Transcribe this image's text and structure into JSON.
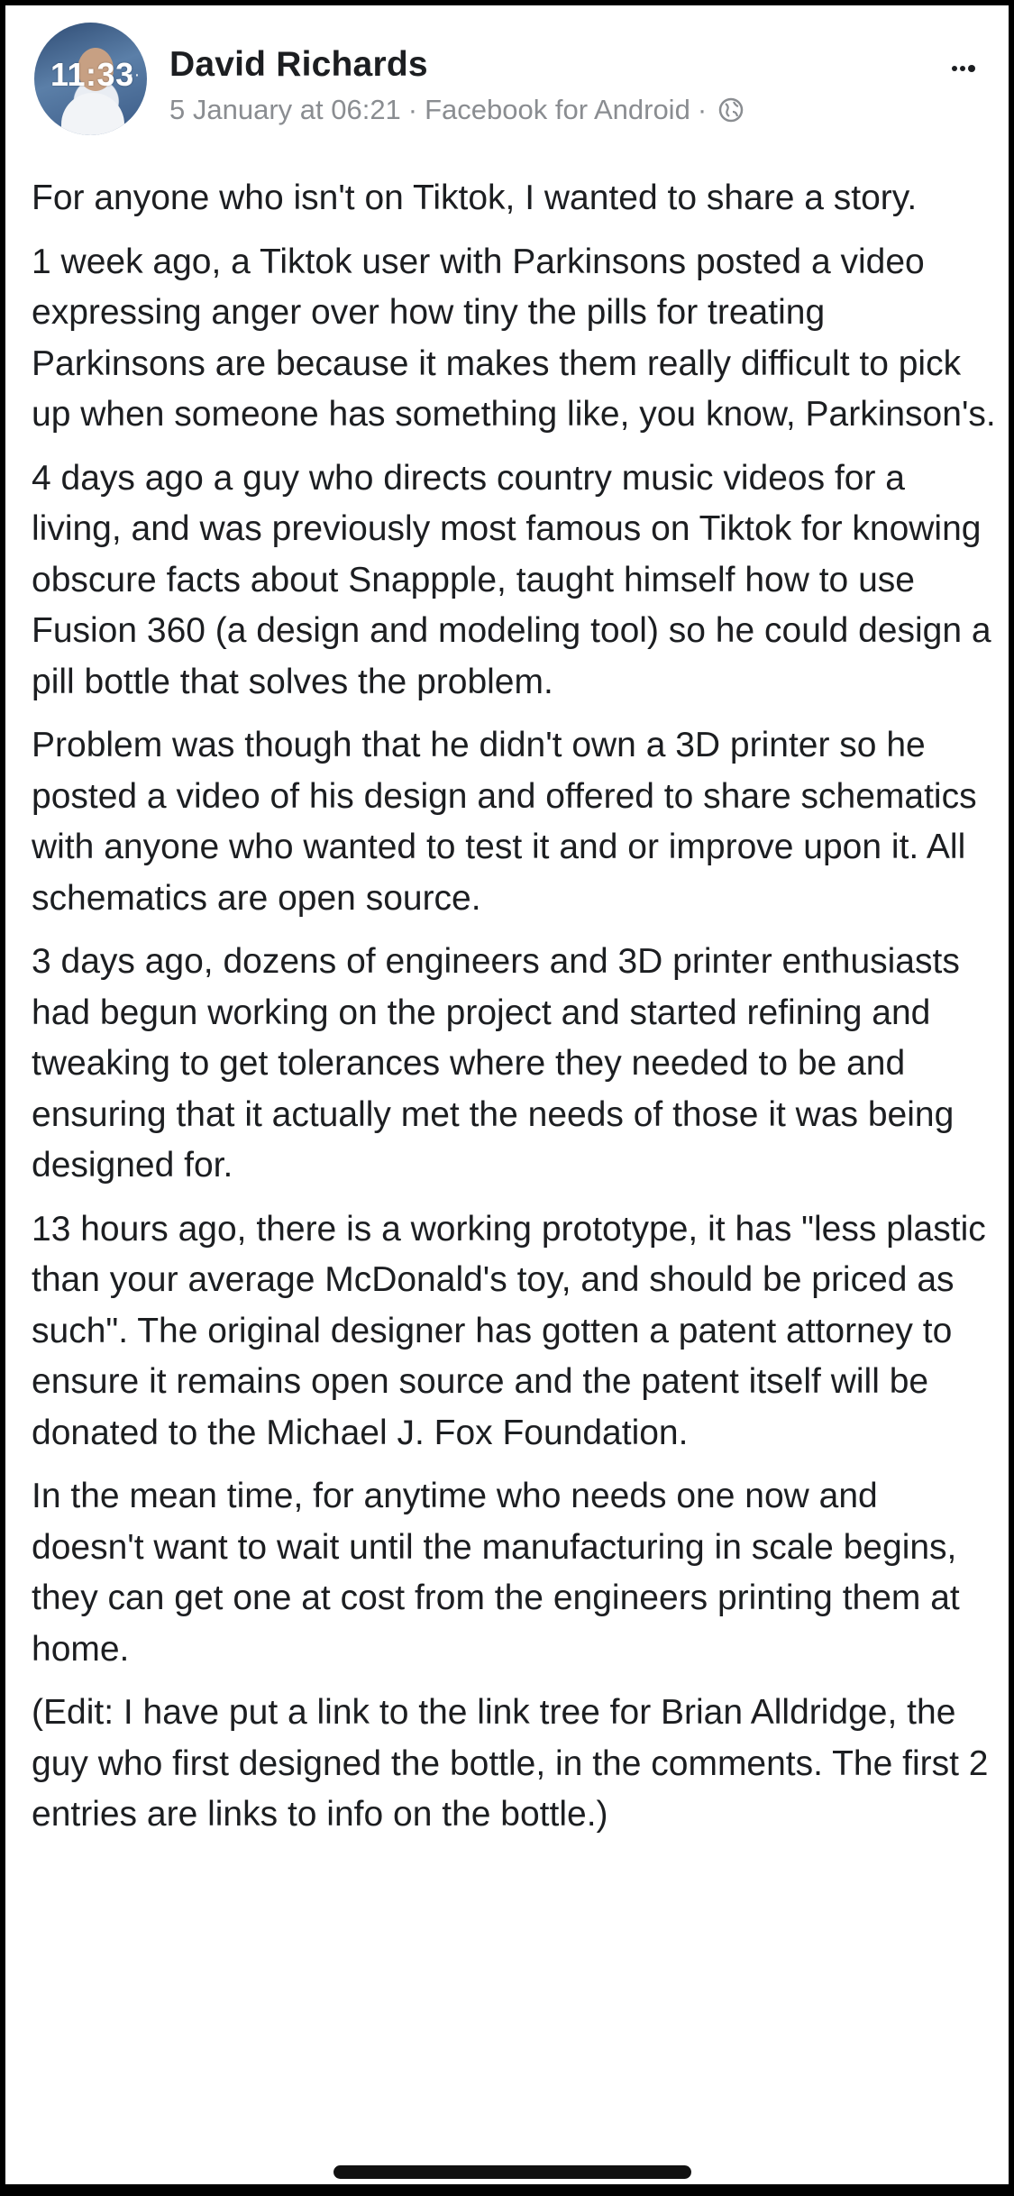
{
  "status_bar": {
    "time": "11:33",
    "dots": "·· ·"
  },
  "post": {
    "author": "David Richards",
    "date": "5 January at 06:21",
    "separator": "·",
    "app": "Facebook for Android",
    "audience_icon": "globe-icon",
    "paragraphs": [
      "For anyone who isn't on Tiktok, I wanted to share a story.",
      "1 week ago, a Tiktok user with Parkinsons posted a video expressing anger over how tiny the pills for treating Parkinsons are because it makes them really difficult to pick up when someone has something like, you know, Parkinson's.",
      "4 days ago a guy who directs country music videos for a living, and was previously most famous on Tiktok for knowing obscure facts about Snappple, taught himself how to use Fusion 360 (a design and modeling tool) so he could design a pill bottle that solves the problem.",
      "Problem was though that he didn't own a 3D printer so he posted a video of his design and offered to share schematics with anyone who wanted to test it and or improve upon it. All schematics are open source.",
      "3 days ago, dozens of engineers and 3D printer enthusiasts had begun working on the project and started refining and tweaking to get tolerances where they needed to be and ensuring that it actually met the needs of those it was being designed for.",
      "13 hours ago, there is a working prototype, it has \"less plastic than your average McDonald's toy, and should be priced as such\". The original designer has gotten a patent attorney to ensure it remains open source and the patent itself will be donated to the Michael J. Fox Foundation.",
      "In the mean time, for anytime who needs one now and doesn't want to wait until the manufacturing in scale begins, they can get one at cost from the engineers printing them at home.",
      "(Edit: I have put a link to the link tree for Brian Alldridge, the guy who first designed the bottle, in the comments. The first 2 entries are links to info on the bottle.)"
    ]
  },
  "colors": {
    "background": "#000000",
    "card": "#ffffff",
    "text": "#1c1e21",
    "meta_text": "#8a8d91"
  }
}
